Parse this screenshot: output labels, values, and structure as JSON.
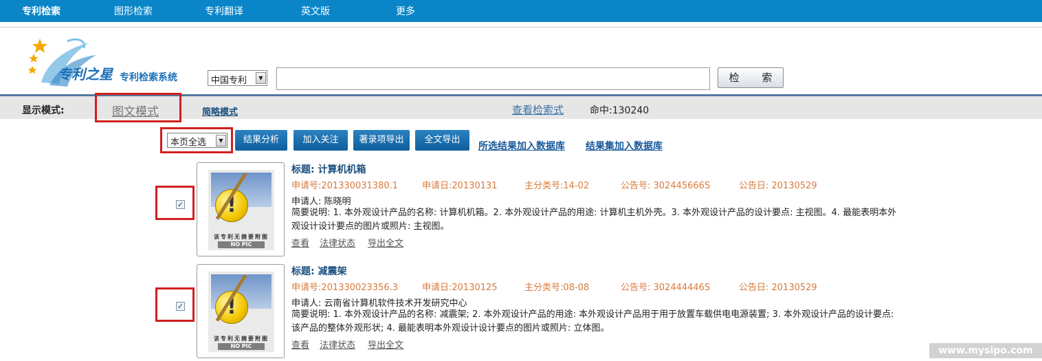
{
  "nav": [
    "专利检索",
    "图形检索",
    "专利翻译",
    "英文版",
    "更多"
  ],
  "logo": {
    "title": "专利之星",
    "subtitle": "专利检索系统"
  },
  "search": {
    "db_selected": "中国专利",
    "query_value": "",
    "button_label": "检 索"
  },
  "display_mode": {
    "label": "显示模式:",
    "graphic": "图文模式",
    "brief": "简略模式",
    "view_query": "查看检索式",
    "hit_count": "命中:130240"
  },
  "toolbar": {
    "select_value": "本页全选",
    "buttons": [
      "结果分析",
      "加入关注",
      "著录项导出",
      "全文导出"
    ],
    "links": [
      "所选结果加入数据库",
      "结果集加入数据库"
    ]
  },
  "results": [
    {
      "checked": "✓",
      "title": "标题: 计算机机箱",
      "app_no": "申请号:201330031380.1",
      "app_date": "申请日:20130131",
      "main_class": "主分类号:14-02",
      "pub_no": "公告号: 302445666S",
      "pub_date": "公告日: 20130529",
      "applicant": "申请人: 陈晓明",
      "summary": "简要说明: 1. 本外观设计产品的名称: 计算机机箱。2. 本外观设计产品的用途: 计算机主机外壳。3. 本外观设计产品的设计要点: 主视图。4. 最能表明本外观设计设计要点的图片或照片: 主视图。",
      "thumb_caption": "该专利无摘要附图",
      "thumb_nopic": "NO PIC",
      "actions": [
        "查看",
        "法律状态",
        "导出全文"
      ]
    },
    {
      "checked": "✓",
      "title": "标题: 减震架",
      "app_no": "申请号:201330023356.3",
      "app_date": "申请日:20130125",
      "main_class": "主分类号:08-08",
      "pub_no": "公告号: 302444446S",
      "pub_date": "公告日: 20130529",
      "applicant": "申请人: 云南省计算机软件技术开发研究中心",
      "summary": "简要说明: 1. 本外观设计产品的名称: 减震架; 2. 本外观设计产品的用途: 本外观设计产品用于用于放置车载供电电源装置; 3. 本外观设计产品的设计要点: 该产品的整体外观形状; 4. 最能表明本外观设计设计要点的图片或照片: 立体图。",
      "thumb_caption": "该专利无摘要附图",
      "thumb_nopic": "NO PIC",
      "actions": [
        "查看",
        "法律状态",
        "导出全文"
      ]
    }
  ],
  "watermark": "www.mysipo.com",
  "colors": {
    "nav_bg": "#0a86c8",
    "meta_orange": "#d87a3a",
    "title_blue": "#1a4f7e",
    "highlight_red": "#d11f1f"
  }
}
